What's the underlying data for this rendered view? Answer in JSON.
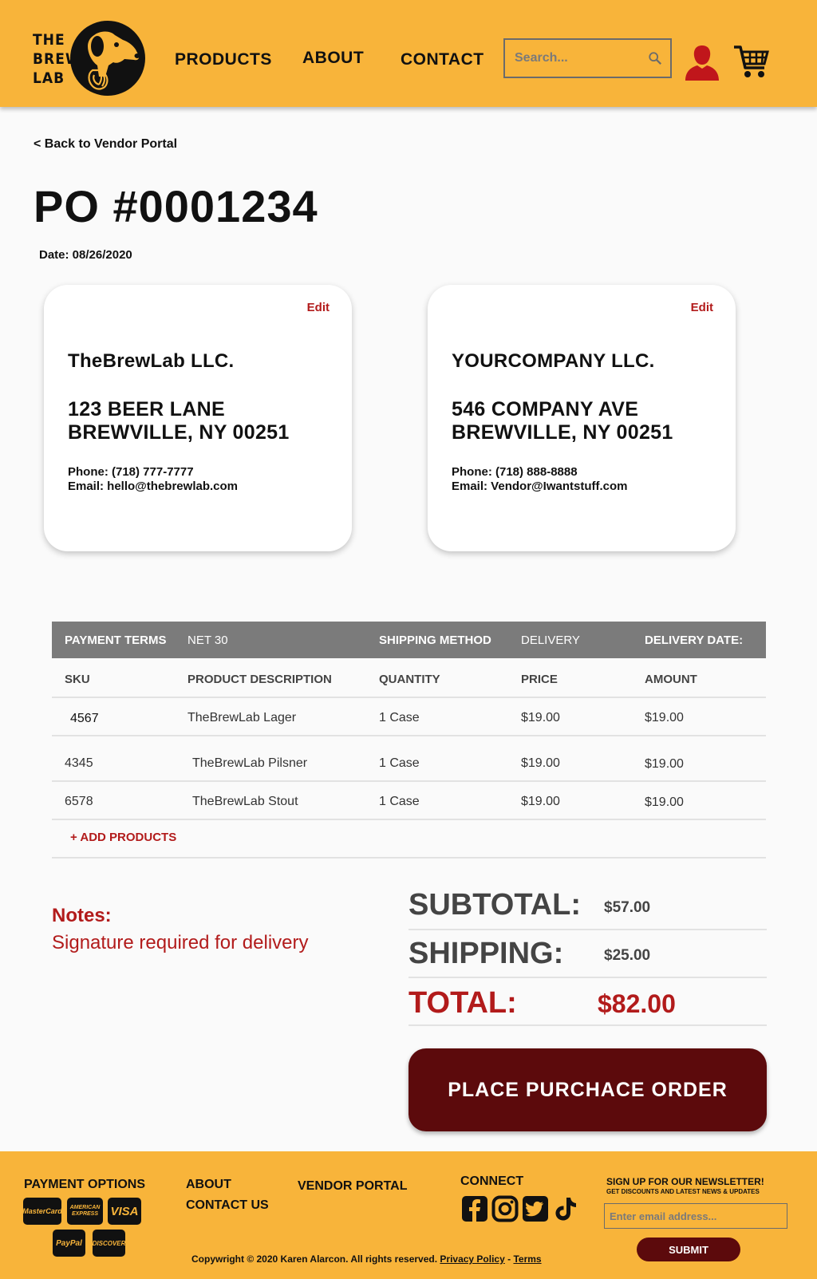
{
  "header": {
    "logo_lines": [
      "THE",
      "BREW",
      "LAB"
    ],
    "nav": [
      "PRODUCTS",
      "ABOUT",
      "CONTACT"
    ],
    "search_placeholder": "Search...",
    "colors": {
      "brand": "#f8b43a",
      "accent": "#b21b1b",
      "dark": "#5c0a0c"
    }
  },
  "page": {
    "back_link": "< Back to Vendor Portal",
    "po_title": "PO #0001234",
    "date": "Date: 08/26/2020"
  },
  "cards": [
    {
      "edit": "Edit",
      "company": "TheBrewLab LLC.",
      "address_line1": "123 BEER LANE",
      "address_line2": "BREWVILLE, NY 00251",
      "phone": "Phone: (718) 777-7777",
      "email": "Email: hello@thebrewlab.com"
    },
    {
      "edit": "Edit",
      "company": "YOURCOMPANY LLC.",
      "address_line1": "546 COMPANY AVE",
      "address_line2": "BREWVILLE, NY 00251",
      "phone": "Phone: (718) 888-8888",
      "email": "Email: Vendor@Iwantstuff.com"
    }
  ],
  "terms": {
    "payment_terms_label": "PAYMENT TERMS",
    "payment_terms_value": "NET 30",
    "shipping_method_label": "SHIPPING METHOD",
    "shipping_method_value": "DELIVERY",
    "delivery_date_label": "DELIVERY DATE:"
  },
  "table": {
    "columns": [
      "SKU",
      "PRODUCT DESCRIPTION",
      "QUANTITY",
      "PRICE",
      "AMOUNT"
    ],
    "rows": [
      {
        "sku": "4567",
        "description": "TheBrewLab Lager",
        "quantity": "1 Case",
        "price": "$19.00",
        "amount": "$19.00"
      },
      {
        "sku": "4345",
        "description": "TheBrewLab Pilsner",
        "quantity": "1 Case",
        "price": "$19.00",
        "amount": "$19.00"
      },
      {
        "sku": "6578",
        "description": "TheBrewLab Stout",
        "quantity": "1 Case",
        "price": "$19.00",
        "amount": "$19.00"
      }
    ],
    "add_products": "+ ADD PRODUCTS"
  },
  "notes": {
    "label": "Notes:",
    "text": "Signature required for delivery"
  },
  "totals": {
    "subtotal_label": "SUBTOTAL:",
    "subtotal_value": "$57.00",
    "shipping_label": "SHIPPING:",
    "shipping_value": "$25.00",
    "total_label": "TOTAL:",
    "total_value": "$82.00"
  },
  "place_order": "PLACE PURCHACE ORDER",
  "footer": {
    "payment_options": "PAYMENT OPTIONS",
    "payment_cards": [
      "MasterCard",
      "AMERICAN EXPRESS",
      "VISA",
      "PayPal",
      "DISCOVER"
    ],
    "links": [
      "ABOUT",
      "CONTACT US"
    ],
    "vendor_portal": "VENDOR PORTAL",
    "connect": "CONNECT",
    "social_icons": [
      "facebook-icon",
      "instagram-icon",
      "twitter-icon",
      "tiktok-icon"
    ],
    "newsletter_title": "SIGN UP FOR OUR NEWSLETTER!",
    "newsletter_sub": "GET DISCOUNTS AND LATEST NEWS & UPDATES",
    "email_placeholder": "Enter email address...",
    "submit": "SUBMIT",
    "copyright": "Copywright © 2020 Karen Alarcon. All rights reserved.",
    "privacy": "Privacy Policy",
    "separator": " - ",
    "terms": "Terms"
  }
}
